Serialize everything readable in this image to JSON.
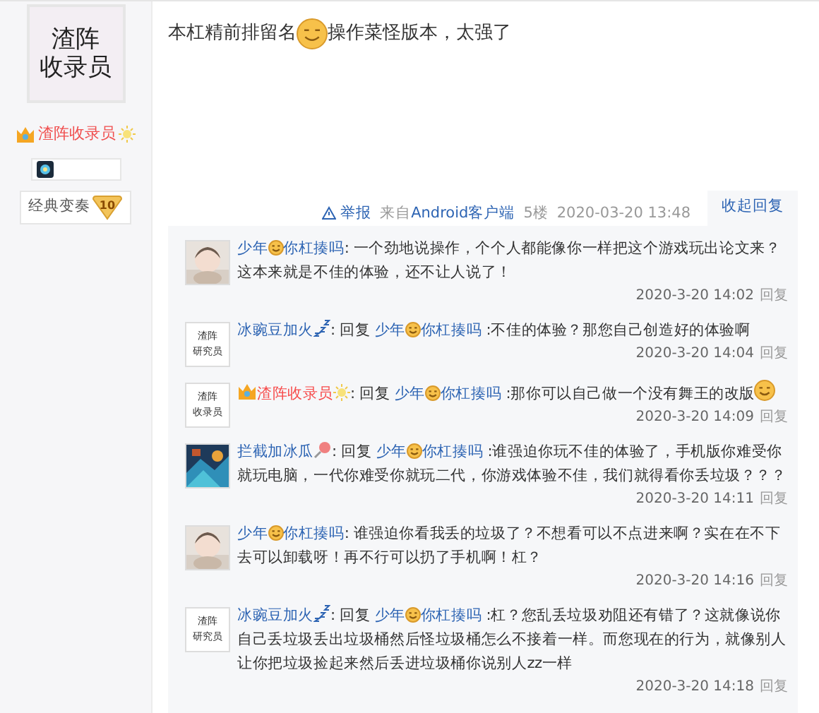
{
  "author": {
    "avatar_text": [
      "渣阵",
      "收录员"
    ],
    "name": "渣阵收录员",
    "badge": {
      "label": "经典变奏",
      "level": "10"
    }
  },
  "post": {
    "text_before": "本杠精前排留名",
    "text_after": "操作菜怪版本，太强了"
  },
  "footer": {
    "report": "举报",
    "source_prefix": "来自",
    "source": "Android客户端",
    "floor": "5楼",
    "time": "2020-03-20 13:48",
    "toggle": "收起回复"
  },
  "replies": [
    {
      "user": {
        "parts": [
          "少年",
          "你杠揍吗"
        ],
        "color": "#2d64b3"
      },
      "text": ": 一个劲地说操作，个个人都能像你一样把这个游戏玩出论文来？这本来就是不佳的体验，还不让人说了！",
      "time": "2020-3-20 14:02",
      "action": "回复"
    },
    {
      "avatar": {
        "kind": "text",
        "lines": [
          "渣阵",
          "研究员"
        ]
      },
      "user": {
        "parts": [
          "冰豌豆加火"
        ],
        "color": "#2d64b3",
        "suffix": {
          "kind": "zzz"
        }
      },
      "reply_word": ": 回复",
      "reply_to": [
        "少年",
        "你杠揍吗"
      ],
      "text": " :不佳的体验？那您自己创造好的体验啊",
      "time": "2020-3-20 14:04",
      "action": "回复"
    },
    {
      "avatar": {
        "kind": "text",
        "lines": [
          "渣阵",
          "收录员"
        ]
      },
      "user": {
        "parts": [
          "渣阵收录员"
        ],
        "color": "#f74c4c",
        "prefix": {
          "kind": "crown"
        },
        "suffix": {
          "kind": "sun"
        }
      },
      "reply_word": ": 回复",
      "reply_to": [
        "少年",
        "你杠揍吗"
      ],
      "text": " :那你可以自己做一个没有舞王的改版",
      "emoji_end": true,
      "time": "2020-3-20 14:09",
      "action": "回复"
    },
    {
      "user": {
        "parts": [
          "拦截加冰瓜"
        ],
        "color": "#2d64b3",
        "suffix": {
          "kind": "lollipop"
        }
      },
      "reply_word": ": 回复",
      "reply_to": [
        "少年",
        "你杠揍吗"
      ],
      "text": " :谁强迫你玩不佳的体验了，手机版你难受你就玩电脑，一代你难受你就玩二代，你游戏体验不佳，我们就得看你丢垃圾？？？",
      "time": "2020-3-20 14:11",
      "action": "回复"
    },
    {
      "user": {
        "parts": [
          "少年",
          "你杠揍吗"
        ],
        "color": "#2d64b3"
      },
      "text": ": 谁强迫你看我丢的垃圾了？不想看可以不点进来啊？实在在不下去可以卸载呀！再不行可以扔了手机啊！杠？",
      "time": "2020-3-20 14:16",
      "action": "回复"
    },
    {
      "avatar": {
        "kind": "text",
        "lines": [
          "渣阵",
          "研究员"
        ]
      },
      "user": {
        "parts": [
          "冰豌豆加火"
        ],
        "color": "#2d64b3",
        "suffix": {
          "kind": "zzz"
        }
      },
      "reply_word": ": 回复",
      "reply_to": [
        "少年",
        "你杠揍吗"
      ],
      "text": " :杠？您乱丢垃圾劝阻还有错了？这就像说你自己丢垃圾丢出垃圾桶然后怪垃圾桶怎么不接着一样。而您现在的行为，就像别人让你把垃圾捡起来然后丢进垃圾桶你说别人zz一样",
      "time": "2020-3-20 14:18",
      "action": "回复"
    }
  ]
}
